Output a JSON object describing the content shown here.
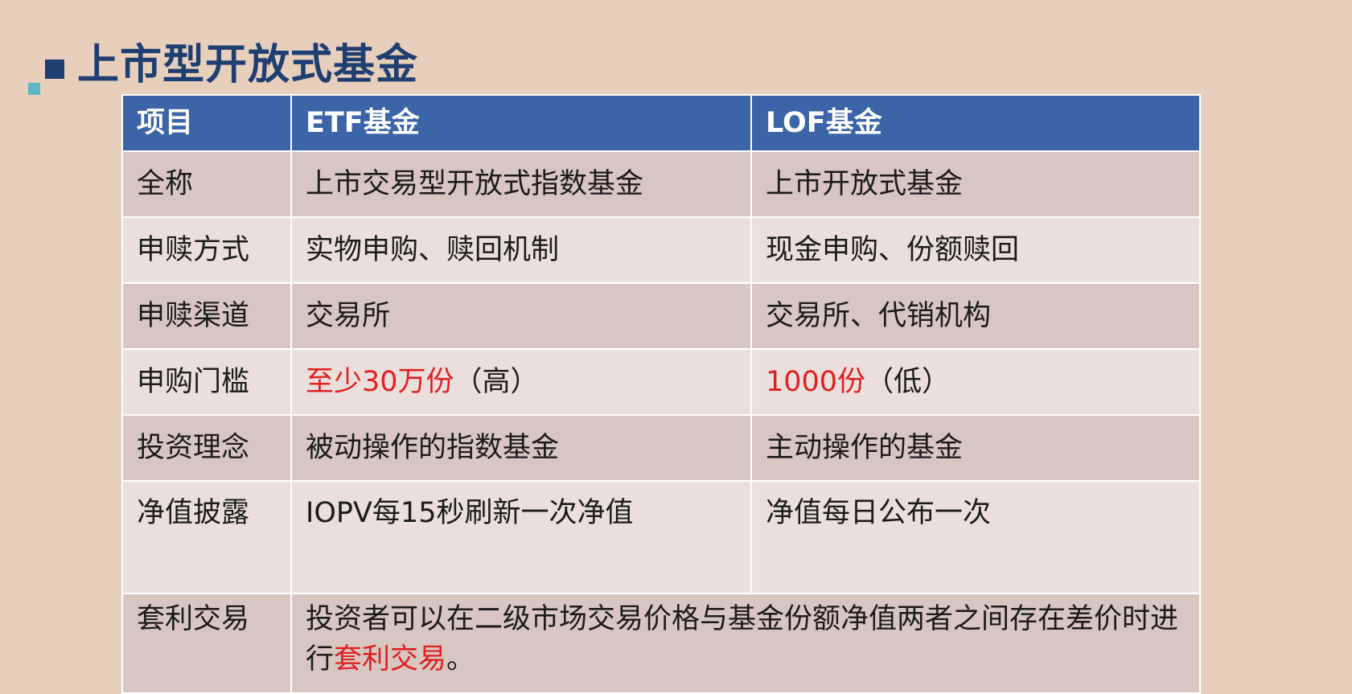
{
  "title": "上市型开放式基金",
  "colors": {
    "title": "#1f3f73",
    "header_bg": "#3b65a7",
    "row_dark": "#d8c6c2",
    "row_light": "#eadfdd",
    "highlight": "#e02020",
    "deco_dark": "#1f3f73",
    "deco_light": "#5fb6c4"
  },
  "table": {
    "headers": [
      "项目",
      "ETF基金",
      "LOF基金"
    ],
    "rows": [
      {
        "item": "全称",
        "etf": "上市交易型开放式指数基金",
        "lof": "上市开放式基金"
      },
      {
        "item": "申赎方式",
        "etf": "实物申购、赎回机制",
        "lof": "现金申购、份额赎回"
      },
      {
        "item": "申赎渠道",
        "etf": "交易所",
        "lof": "交易所、代销机构"
      },
      {
        "item": "申购门槛",
        "etf_highlight": "至少30万份",
        "etf_rest": "（高）",
        "lof_highlight": "1000份",
        "lof_rest": "（低）"
      },
      {
        "item": "投资理念",
        "etf": "被动操作的指数基金",
        "lof": "主动操作的基金"
      },
      {
        "item": "净值披露",
        "etf": "IOPV每15秒刷新一次净值",
        "lof": "净值每日公布一次"
      }
    ],
    "last_row": {
      "item": "套利交易",
      "text_before": "投资者可以在二级市场交易价格与基金份额净值两者之间存在差价时进行",
      "text_highlight": "套利交易",
      "text_after": "。"
    }
  }
}
